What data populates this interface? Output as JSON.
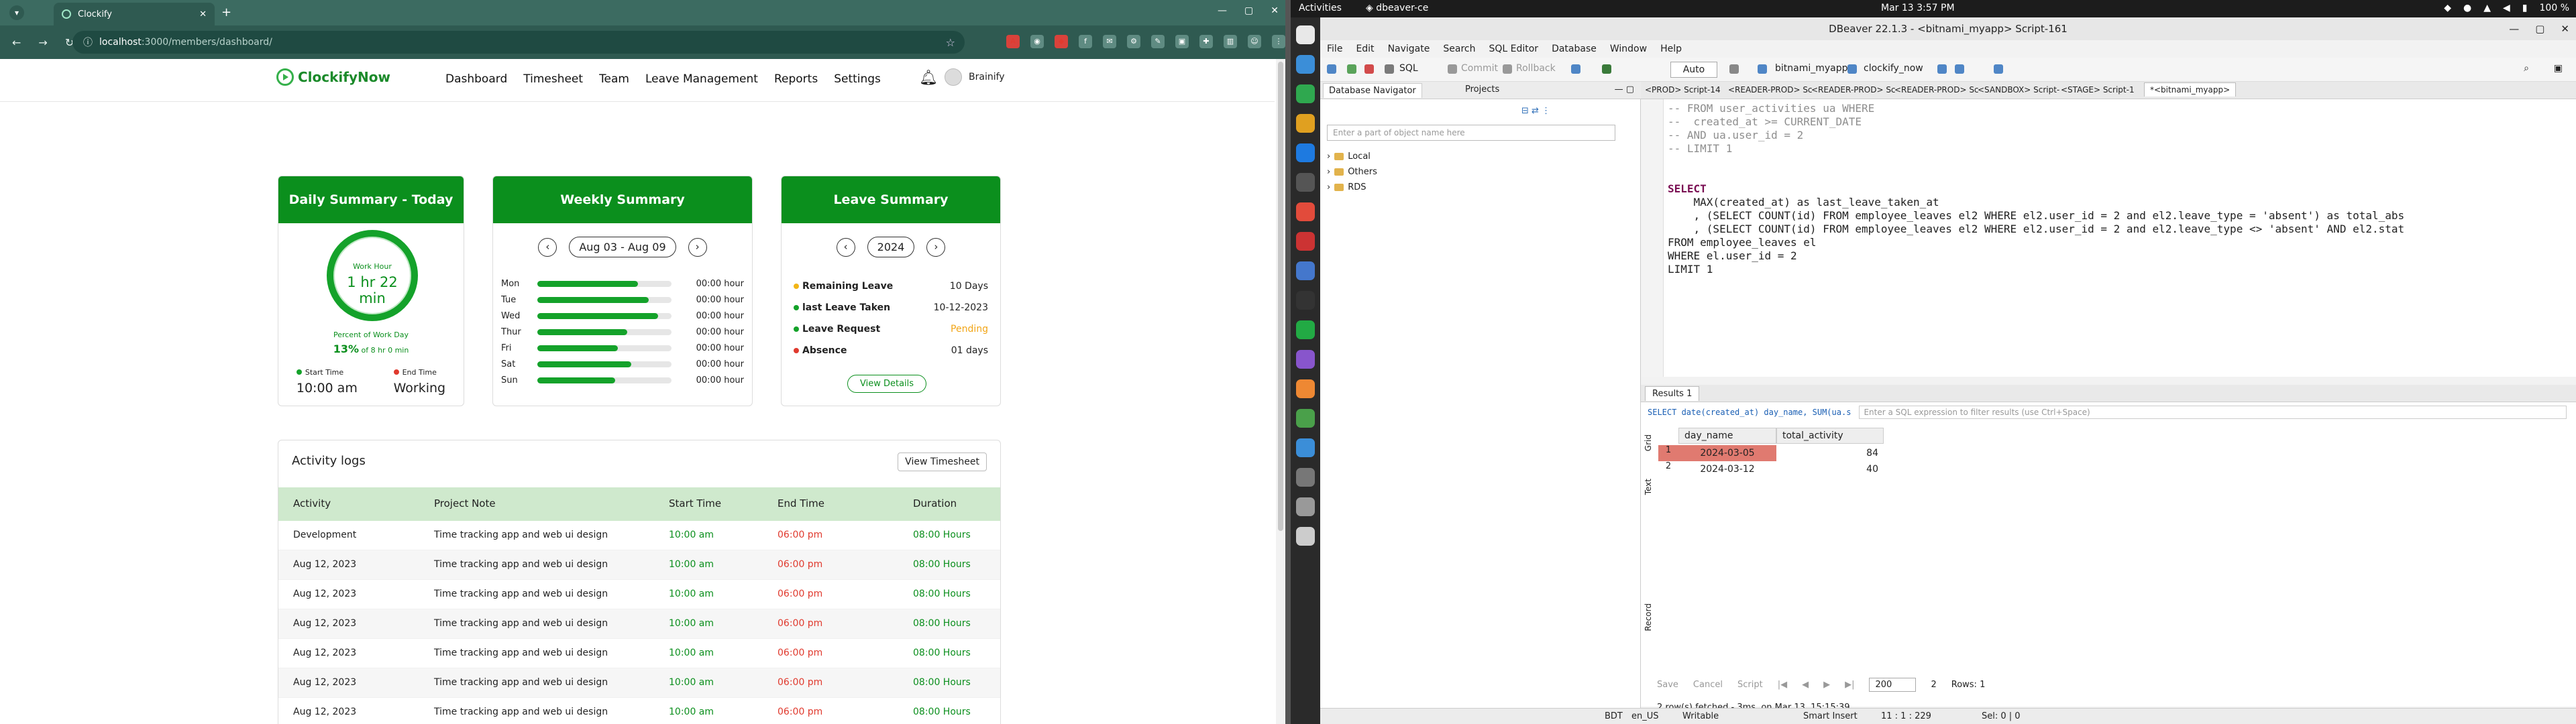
{
  "browser": {
    "tab_title": "Clockify",
    "url_host": "localhost",
    "url_path": ":3000/members/dashboard/"
  },
  "app": {
    "brand": "ClockifyNow",
    "nav": [
      "Dashboard",
      "Timesheet",
      "Team",
      "Leave Management",
      "Reports",
      "Settings"
    ],
    "user_name": "Brainify"
  },
  "daily": {
    "title": "Daily Summary - Today",
    "work_hour_label": "Work Hour",
    "work_hour_value": "1 hr 22 min",
    "percent_label": "Percent of Work Day",
    "percent_value": "13%",
    "percent_suffix": "of 8 hr 0 min",
    "start_label": "Start Time",
    "start_value": "10:00 am",
    "end_label": "End Time",
    "end_value": "Working"
  },
  "weekly": {
    "title": "Weekly Summary",
    "range": "Aug 03 - Aug 09",
    "days": [
      {
        "day": "Mon",
        "hours": "00:00 hour",
        "fill": 0.75
      },
      {
        "day": "Tue",
        "hours": "00:00 hour",
        "fill": 0.83
      },
      {
        "day": "Wed",
        "hours": "00:00 hour",
        "fill": 0.9
      },
      {
        "day": "Thur",
        "hours": "00:00 hour",
        "fill": 0.67
      },
      {
        "day": "Fri",
        "hours": "00:00 hour",
        "fill": 0.6
      },
      {
        "day": "Sat",
        "hours": "00:00 hour",
        "fill": 0.7
      },
      {
        "day": "Sun",
        "hours": "00:00 hour",
        "fill": 0.58
      }
    ]
  },
  "leave": {
    "title": "Leave Summary",
    "year": "2024",
    "items": [
      {
        "label": "Remaining Leave",
        "value": "10 Days",
        "dot": "#f2b516"
      },
      {
        "label": "last Leave Taken",
        "value": "10-12-2023",
        "dot": "#14a22a"
      },
      {
        "label": "Leave Request",
        "value": "Pending",
        "dot": "#14a22a"
      },
      {
        "label": "Absence",
        "value": "01 days",
        "dot": "#e03a2e"
      }
    ],
    "details_label": "View Details"
  },
  "activity": {
    "title": "Activity logs",
    "view_label": "View Timesheet",
    "headers": [
      "Activity",
      "Project Note",
      "Start Time",
      "End Time",
      "Duration"
    ],
    "rows": [
      {
        "activity": "Development",
        "note": "Time tracking app and web ui design",
        "start": "10:00 am",
        "end": "06:00 pm",
        "duration": "08:00 Hours"
      },
      {
        "activity": "Aug 12, 2023",
        "note": "Time tracking app and web ui design",
        "start": "10:00 am",
        "end": "06:00 pm",
        "duration": "08:00 Hours"
      },
      {
        "activity": "Aug 12, 2023",
        "note": "Time tracking app and web ui design",
        "start": "10:00 am",
        "end": "06:00 pm",
        "duration": "08:00 Hours"
      },
      {
        "activity": "Aug 12, 2023",
        "note": "Time tracking app and web ui design",
        "start": "10:00 am",
        "end": "06:00 pm",
        "duration": "08:00 Hours"
      },
      {
        "activity": "Aug 12, 2023",
        "note": "Time tracking app and web ui design",
        "start": "10:00 am",
        "end": "06:00 pm",
        "duration": "08:00 Hours"
      },
      {
        "activity": "Aug 12, 2023",
        "note": "Time tracking app and web ui design",
        "start": "10:00 am",
        "end": "06:00 pm",
        "duration": "08:00 Hours"
      },
      {
        "activity": "Aug 12, 2023",
        "note": "Time tracking app and web ui design",
        "start": "10:00 am",
        "end": "06:00 pm",
        "duration": "08:00 Hours"
      }
    ]
  },
  "desktop": {
    "activities": "Activities",
    "app_name": "dbeaver-ce",
    "clock": "Mar 13  3:57 PM",
    "battery": "100 %"
  },
  "dbeaver": {
    "title": "DBeaver 22.1.3 - <bitnami_myapp> Script-161",
    "menu": [
      "File",
      "Edit",
      "Navigate",
      "Search",
      "SQL Editor",
      "Database",
      "Window",
      "Help"
    ],
    "toolbar": {
      "sql": "SQL",
      "commit": "Commit",
      "rollback": "Rollback",
      "auto": "Auto",
      "datasource": "bitnami_myapp",
      "schema": "clockify_now"
    },
    "nav_tabs": [
      "Database Navigator",
      "Projects"
    ],
    "nav_filter": "Enter a part of object name here",
    "tree": [
      "Local",
      "Others",
      "RDS"
    ],
    "editor_tabs": [
      "<PROD> Script-14",
      "<READER-PROD> Sc",
      "<READER-PROD> Sc",
      "<READER-PROD> Sc",
      "<SANDBOX> Script-",
      "<STAGE> Script-1",
      "*<bitnami_myapp>"
    ],
    "code": {
      "c1": "-- FROM user_activities ua WHERE",
      "c2": "--  created_at >= CURRENT_DATE",
      "c3": "-- AND ua.user_id = 2",
      "c4": "-- LIMIT 1",
      "l1": "SELECT",
      "l2a": "    MAX(created_at) as last_leave_taken_at",
      "l3a": "    , (SELECT COUNT(id) FROM employee_leaves el2 WHERE el2.user_id = 2 and el2.leave_type = 'absent') as total_abs",
      "l4a": "    , (SELECT COUNT(id) FROM employee_leaves el2 WHERE el2.user_id = 2 and el2.leave_type <> 'absent' AND el2.stat",
      "l5": "FROM employee_leaves el",
      "l6": "WHERE el.user_id = 2",
      "l7": "LIMIT 1"
    },
    "results": {
      "tab": "Results 1",
      "filter_sql": "SELECT date(created_at) day_name, SUM(ua.s",
      "filter_hint": "Enter a SQL expression to filter results (use Ctrl+Space)",
      "columns": [
        "day_name",
        "total_activity"
      ],
      "rows": [
        {
          "n": "1",
          "day": "2024-03-05",
          "total": "84"
        },
        {
          "n": "2",
          "day": "2024-03-12",
          "total": "40"
        }
      ],
      "side_tabs": [
        "Grid",
        "Text",
        "Record"
      ],
      "save": "Save",
      "cancel": "Cancel",
      "script": "Script",
      "limit": "200",
      "fetched_count": "2",
      "rows_label": "Rows: 1",
      "status": "2 row(s) fetched - 3ms, on Mar 13, 15:15:39"
    },
    "statusbar": {
      "tz": "BDT",
      "locale": "en_US",
      "mode": "Writable",
      "insert": "Smart Insert",
      "pos": "11 : 1 : 229",
      "sel": "Sel: 0 | 0"
    }
  }
}
